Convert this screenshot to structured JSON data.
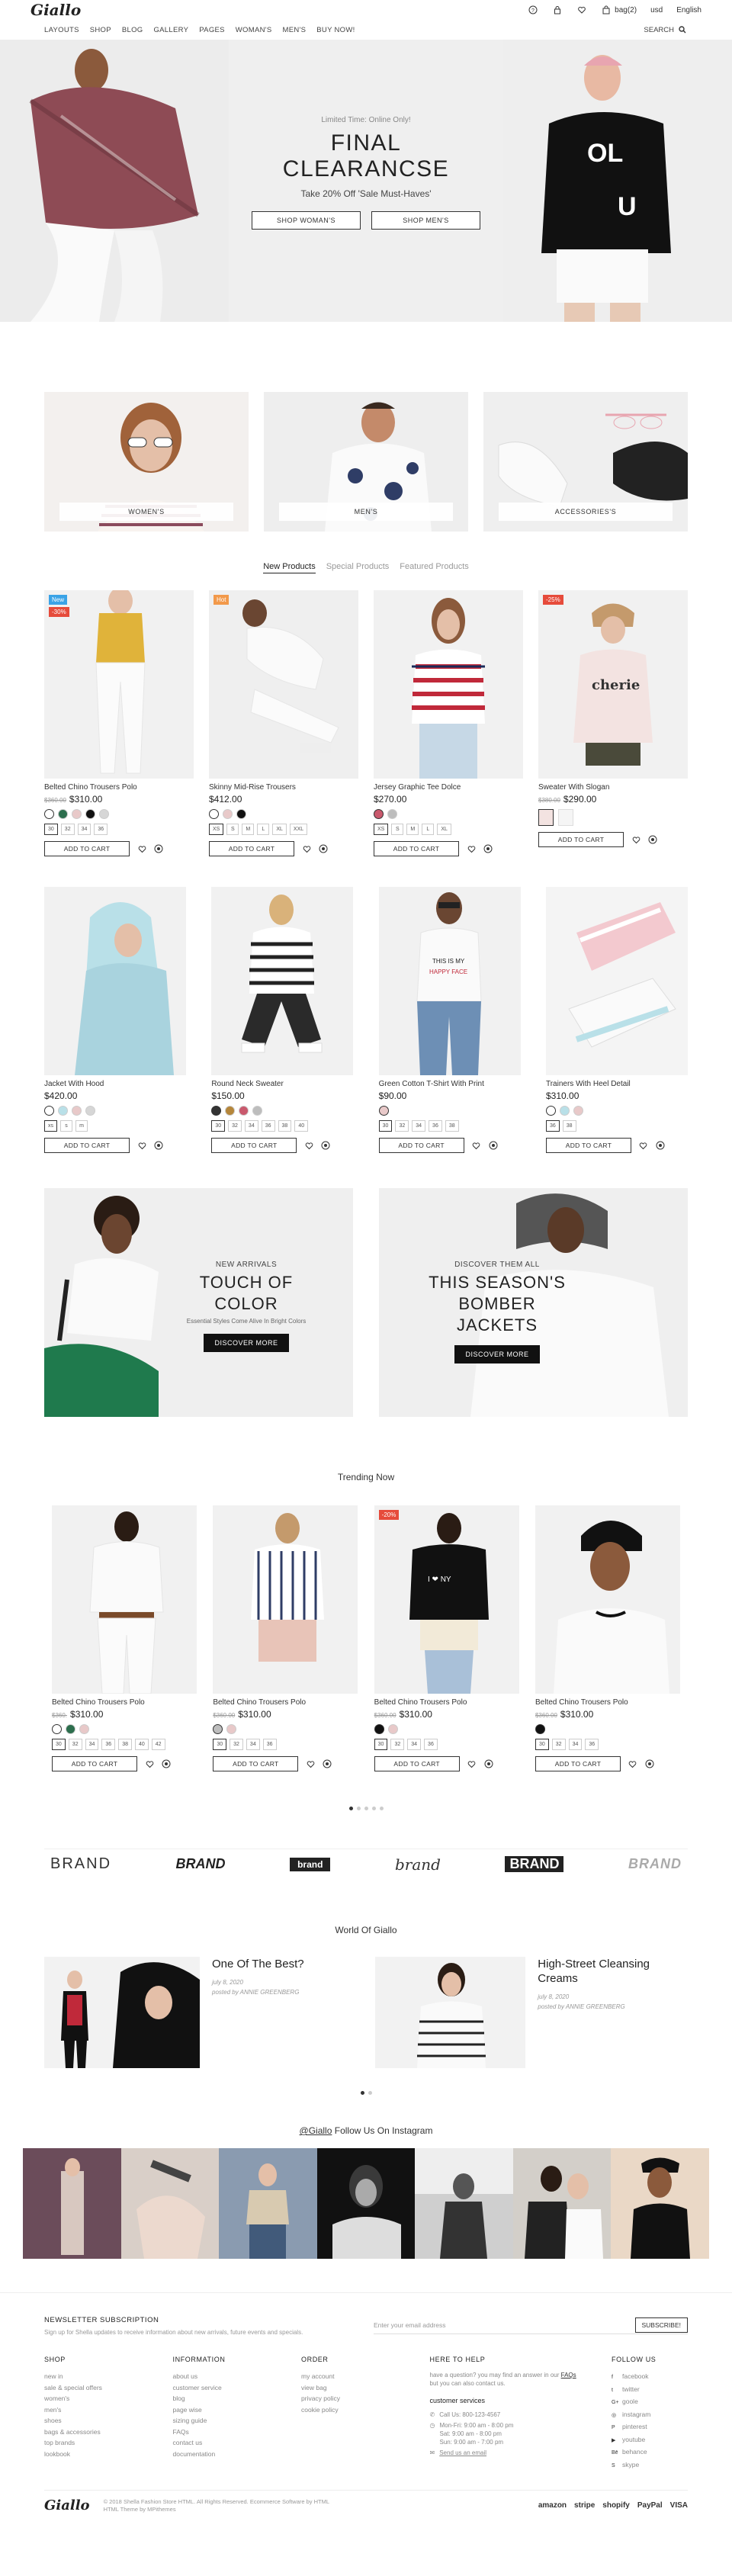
{
  "brand": {
    "logo": "Giallo"
  },
  "topbar": {
    "bag_label": "bag(2)",
    "currency": "usd",
    "language": "English"
  },
  "nav": {
    "items": [
      "LAYOUTS",
      "SHOP",
      "BLOG",
      "GALLERY",
      "PAGES",
      "WOMAN'S",
      "MEN'S",
      "BUY NOW!"
    ],
    "search_label": "SEARCH"
  },
  "hero": {
    "kicker": "Limited Time: Online Only!",
    "title_line1": "FINAL",
    "title_line2": "CLEARANCSE",
    "subtitle": "Take 20% Off 'Sale Must-Haves'",
    "btn_women": "SHOP WOMAN'S",
    "btn_men": "SHOP MEN'S"
  },
  "categories": [
    "WOMEN'S",
    "MEN'S",
    "ACCESSORIES'S"
  ],
  "product_tabs": [
    "New Products",
    "Special Products",
    "Featured Products"
  ],
  "add_to_cart": "ADD TO CART",
  "products_row1": [
    {
      "name": "Belted Chino Trousers Polo",
      "old": "$360.00",
      "price": "$310.00",
      "badges": [
        "New",
        "-30%"
      ],
      "swatches": [
        "#ffffff",
        "#2c6e4d",
        "#e8c9c9",
        "#111111",
        "#d6d6d6"
      ],
      "sizes": [
        "30",
        "32",
        "34",
        "36"
      ]
    },
    {
      "name": "Skinny Mid-Rise Trousers",
      "old": "",
      "price": "$412.00",
      "badges": [
        "Hot"
      ],
      "swatches": [
        "#ffffff",
        "#e8c9c9",
        "#111111"
      ],
      "sizes": [
        "XS",
        "S",
        "M",
        "L",
        "XL",
        "XXL"
      ]
    },
    {
      "name": "Jersey Graphic Tee Dolce",
      "old": "",
      "price": "$270.00",
      "badges": [],
      "swatches": [
        "#c9596d",
        "#bdbdbd"
      ],
      "sizes": [
        "XS",
        "S",
        "M",
        "L",
        "XL"
      ]
    },
    {
      "name": "Sweater With Slogan",
      "old": "$380.00",
      "price": "$290.00",
      "badges": [
        "-25%"
      ],
      "swatches": [],
      "sizes": []
    }
  ],
  "products_row2": [
    {
      "name": "Jacket With Hood",
      "price": "$420.00",
      "swatches": [
        "#ffffff",
        "#b9e0e8",
        "#e8c9c9",
        "#d6d6d6"
      ],
      "sizes": [
        "xs",
        "s",
        "m"
      ]
    },
    {
      "name": "Round Neck Sweater",
      "price": "$150.00",
      "swatches": [
        "#333333",
        "#b5863a",
        "#c9596d",
        "#bdbdbd"
      ],
      "sizes": [
        "30",
        "32",
        "34",
        "36",
        "38",
        "40"
      ]
    },
    {
      "name": "Green Cotton T-Shirt With Print",
      "price": "$90.00",
      "swatches": [
        "#e8c9c9"
      ],
      "sizes": [
        "30",
        "32",
        "34",
        "36",
        "38"
      ]
    },
    {
      "name": "Trainers With Heel Detail",
      "price": "$310.00",
      "swatches": [
        "#ffffff",
        "#b9e0e8",
        "#e8c9c9"
      ],
      "sizes": [
        "36",
        "38"
      ]
    }
  ],
  "promo1": {
    "kicker": "NEW ARRIVALS",
    "title": "TOUCH OF COLOR",
    "subtitle": "Essential Styles Come Alive In Bright Colors",
    "button": "DISCOVER MORE"
  },
  "promo2": {
    "kicker": "DISCOVER THEM ALL",
    "title_line1": "THIS SEASON'S",
    "title_line2": "BOMBER JACKETS",
    "button": "DISCOVER MORE"
  },
  "trending": {
    "title": "Trending Now",
    "items": [
      {
        "name": "Belted Chino Trousers Polo",
        "old": "$360.",
        "price": "$310.00",
        "swatches": [
          "#ffffff",
          "#2c6e4d",
          "#e8c9c9"
        ],
        "sizes": [
          "30",
          "32",
          "34",
          "36",
          "38",
          "40",
          "42"
        ]
      },
      {
        "name": "Belted Chino Trousers Polo",
        "old": "$360.00",
        "price": "$310.00",
        "swatches": [
          "#bdbdbd",
          "#e8c9c9"
        ],
        "sizes": [
          "30",
          "32",
          "34",
          "36"
        ]
      },
      {
        "name": "Belted Chino Trousers Polo",
        "old": "$360.00",
        "price": "$310.00",
        "badge": "-20%",
        "swatches": [
          "#111111",
          "#e8c9c9"
        ],
        "sizes": [
          "30",
          "32",
          "34",
          "36"
        ]
      },
      {
        "name": "Belted Chino Trousers Polo",
        "old": "$360.00",
        "price": "$310.00",
        "swatches": [
          "#111111"
        ],
        "sizes": [
          "30",
          "32",
          "34",
          "36"
        ]
      }
    ]
  },
  "brands": [
    "BRAND",
    "BRAND",
    "brand",
    "brand",
    "BRAND",
    "BRAND"
  ],
  "blog": {
    "title": "World Of Giallo",
    "posts": [
      {
        "title": "One Of The Best?",
        "date": "july 8, 2020",
        "author": "posted by ANNIE GREENBERG"
      },
      {
        "title": "High-Street Cleansing Creams",
        "date": "july 8, 2020",
        "author": "posted by ANNIE GREENBERG"
      }
    ]
  },
  "instagram": {
    "handle": "@Giallo",
    "title_rest": "Follow Us On Instagram"
  },
  "footer": {
    "newsletter_title": "NEWSLETTER SUBSCRIPTION",
    "newsletter_desc": "Sign up for Shella updates to receive information about new arrivals, future events and specials.",
    "email_placeholder": "Enter your email address",
    "subscribe": "SUBSCRIBE!",
    "cols": [
      {
        "title": "SHOP",
        "items": [
          "new in",
          "sale & special offers",
          "women's",
          "men's",
          "shoes",
          "bags & accessories",
          "top brands",
          "lookbook"
        ]
      },
      {
        "title": "INFORMATION",
        "items": [
          "about us",
          "customer service",
          "blog",
          "page wise",
          "sizing guide",
          "FAQs",
          "contact us",
          "documentation"
        ]
      },
      {
        "title": "ORDER",
        "items": [
          "my account",
          "view bag",
          "privacy policy",
          "cookie policy"
        ]
      }
    ],
    "help": {
      "title": "HERE TO HELP",
      "text_a": "have a question? you may find an answer in our",
      "faq_link": "FAQs",
      "text_b": "but you can also contact us.",
      "service_title": "customer services",
      "phone": "Call Us: 800-123-4567",
      "hours1": "Mon-Fri: 9:00 am - 8:00 pm",
      "hours2": "Sat: 9:00 am - 8:00 pm",
      "hours3": "Sun: 9:00 am - 7:00 pm",
      "email_link": "Send us an email"
    },
    "follow": {
      "title": "FOLLOW US",
      "items": [
        "facebook",
        "twitter",
        "goole",
        "instagram",
        "pinterest",
        "youtube",
        "behance",
        "skype"
      ]
    },
    "copyright_a": "© 2018 Shella Fashion Store HTML. All Rights Reserved. Ecommerce Software by HTML",
    "copyright_b": "HTML Theme by MPithemes",
    "payments": [
      "amazon",
      "stripe",
      "shopify",
      "PayPal",
      "VISA"
    ]
  }
}
